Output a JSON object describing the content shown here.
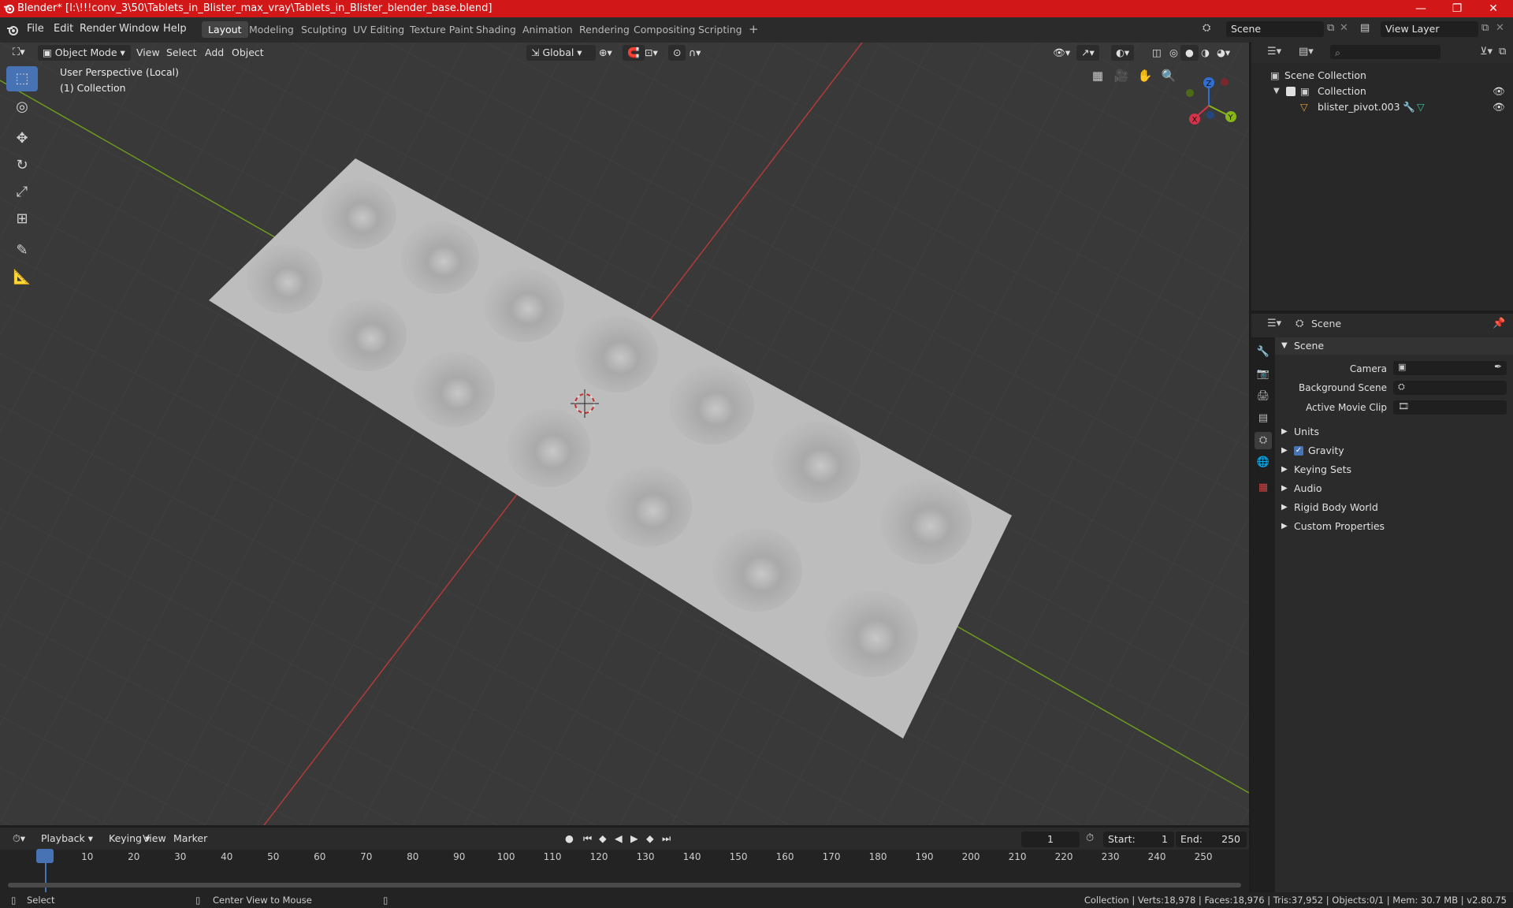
{
  "window": {
    "title": "Blender* [I:\\!!!conv_3\\50\\Tablets_in_Blister_max_vray\\Tablets_in_Blister_blender_base.blend]",
    "controls": [
      "—",
      "❐",
      "✕"
    ]
  },
  "topbar": {
    "menus": [
      "File",
      "Edit",
      "Render",
      "Window",
      "Help"
    ],
    "workspaces": [
      "Layout",
      "Modeling",
      "Sculpting",
      "UV Editing",
      "Texture Paint",
      "Shading",
      "Animation",
      "Rendering",
      "Compositing",
      "Scripting"
    ],
    "active_workspace": "Layout",
    "add_workspace": "+",
    "scene": "Scene",
    "view_layer": "View Layer"
  },
  "viewport": {
    "mode": "Object Mode",
    "menus": [
      "View",
      "Select",
      "Add",
      "Object"
    ],
    "orientation": "Global",
    "overlay_line1": "User Perspective (Local)",
    "overlay_line2": "(1) Collection",
    "gizmo_axes": [
      "X",
      "Y",
      "Z"
    ],
    "colors": {
      "bg": "#393939",
      "grid": "#434343",
      "x_axis": "#b33a3a",
      "y_axis": "#6d9a1e",
      "mesh": "#bdbdbd"
    }
  },
  "outliner": {
    "root": "Scene Collection",
    "collection": "Collection",
    "object": "blister_pivot.003"
  },
  "properties": {
    "header": "Scene",
    "panel": "Scene",
    "fields": [
      "Camera",
      "Background Scene",
      "Active Movie Clip"
    ],
    "sections": [
      "Units",
      "Gravity",
      "Keying Sets",
      "Audio",
      "Rigid Body World",
      "Custom Properties"
    ],
    "gravity_checked": true
  },
  "timeline": {
    "menus": [
      "Playback",
      "Keying",
      "View",
      "Marker"
    ],
    "current_frame": "1",
    "start_label": "Start:",
    "start": "1",
    "end_label": "End:",
    "end": "250",
    "ticks": [
      "1",
      "10",
      "20",
      "30",
      "40",
      "50",
      "60",
      "70",
      "80",
      "90",
      "100",
      "110",
      "120",
      "130",
      "140",
      "150",
      "160",
      "170",
      "180",
      "190",
      "200",
      "210",
      "220",
      "230",
      "240",
      "250"
    ]
  },
  "statusbar": {
    "left": "Select",
    "middle": "Center View to Mouse",
    "right": "Collection | Verts:18,978 | Faces:18,976 | Tris:37,952 | Objects:0/1 | Mem: 30.7 MB | v2.80.75"
  }
}
